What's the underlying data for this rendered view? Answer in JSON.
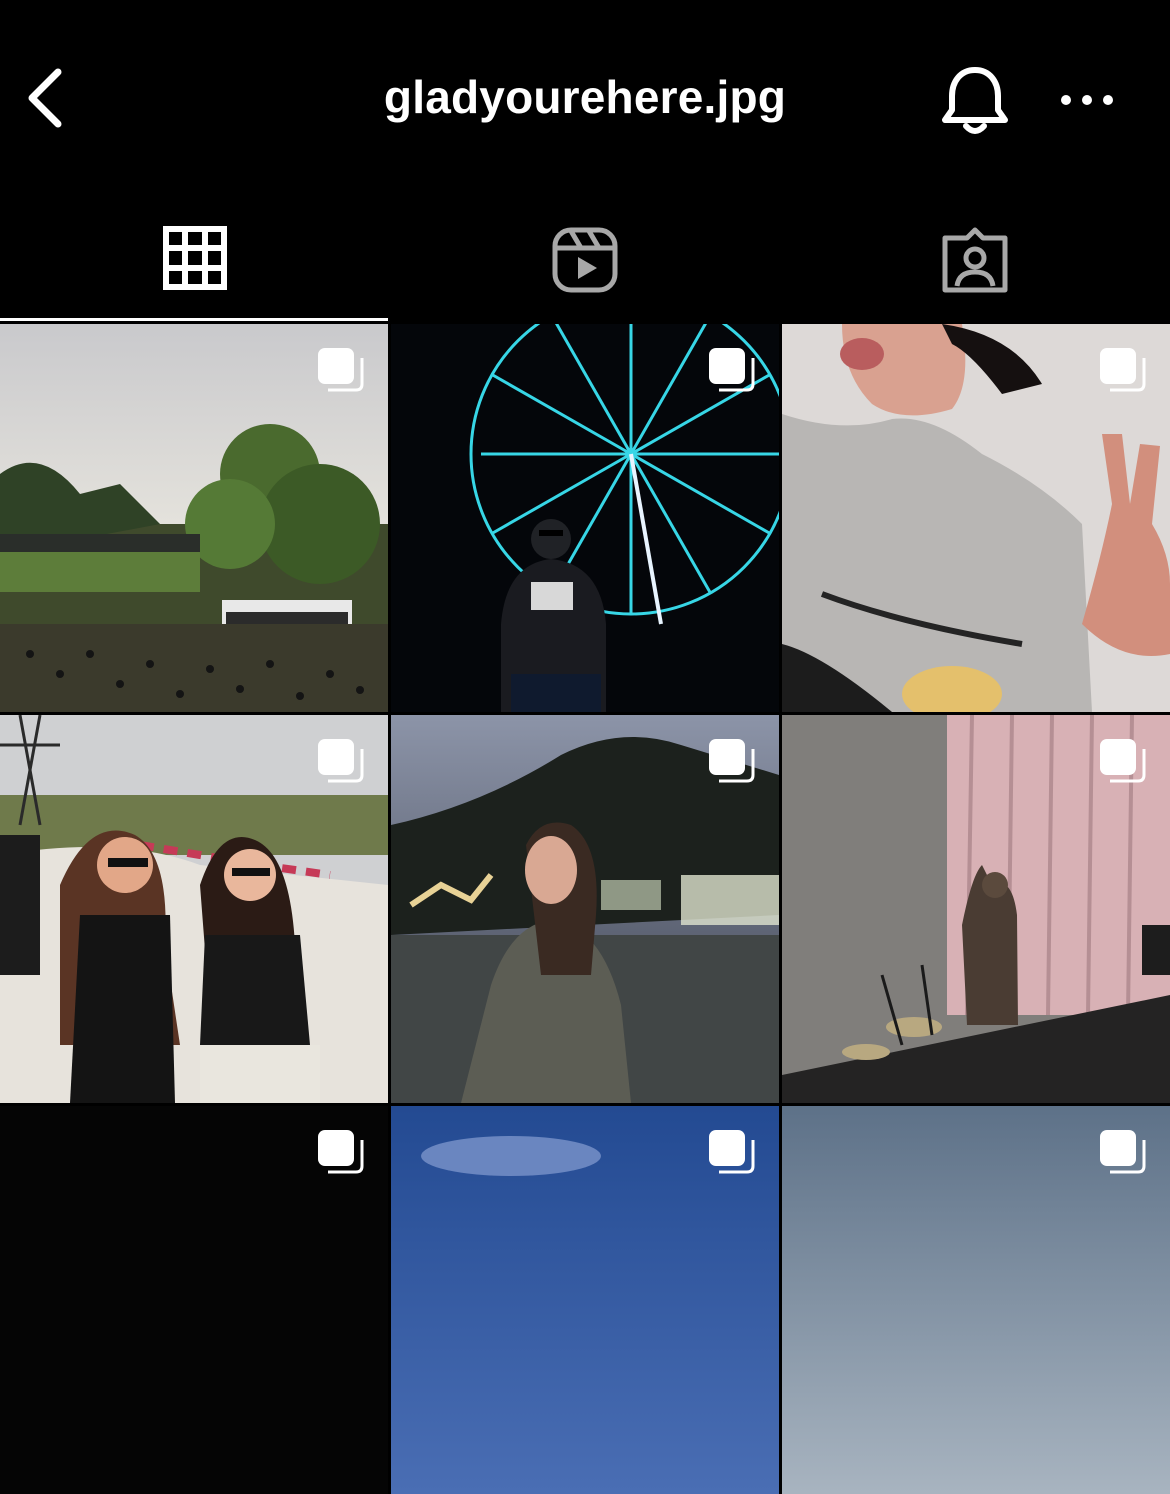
{
  "header": {
    "username": "gladyourehere.jpg",
    "back_icon": "chevron-left-icon",
    "notifications_icon": "bell-icon",
    "more_icon": "ellipsis-icon"
  },
  "tabs": [
    {
      "name": "posts-grid",
      "icon": "grid-icon",
      "active": true
    },
    {
      "name": "reels",
      "icon": "reels-icon",
      "active": false
    },
    {
      "name": "tagged",
      "icon": "tagged-person-icon",
      "active": false
    }
  ],
  "posts": [
    {
      "icon": "carousel-icon"
    },
    {
      "icon": "carousel-icon"
    },
    {
      "icon": "carousel-icon"
    },
    {
      "icon": "carousel-icon"
    },
    {
      "icon": "carousel-icon"
    },
    {
      "icon": "carousel-icon"
    },
    {
      "icon": "carousel-icon"
    },
    {
      "icon": "carousel-icon"
    },
    {
      "icon": "carousel-icon"
    }
  ],
  "colors": {
    "background": "#000000",
    "text": "#ffffff",
    "inactive_icon": "#a8a8a8"
  }
}
